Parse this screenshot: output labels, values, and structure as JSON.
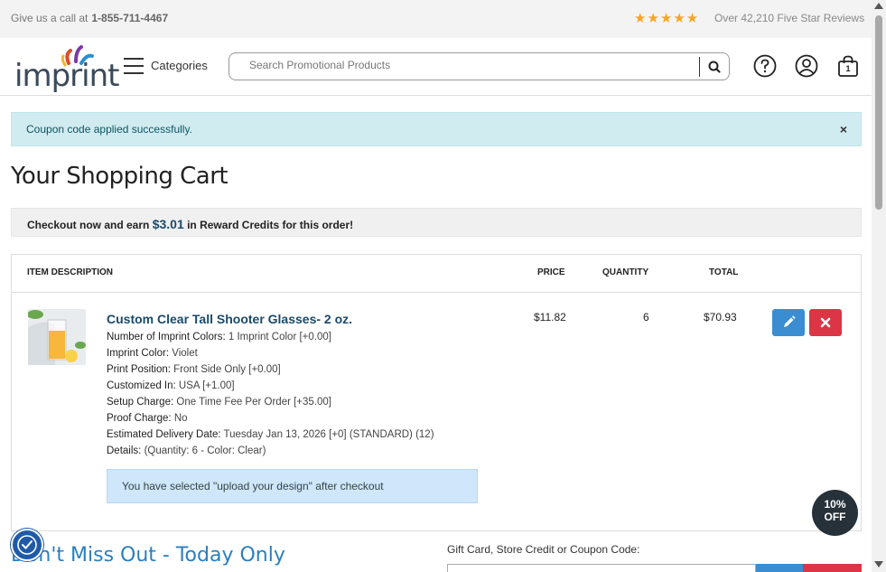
{
  "topbar": {
    "call_text": "Give us a call at",
    "phone": "1-855-711-4467",
    "stars": "★★★★★",
    "reviews": "Over 42,210 Five Star Reviews"
  },
  "header": {
    "logo_text": "imprint",
    "categories_label": "Categories",
    "search_placeholder": "Search Promotional Products",
    "cart_count": "1"
  },
  "alert": {
    "message": "Coupon code applied successfully.",
    "close": "×"
  },
  "page_title": "Your Shopping Cart",
  "reward": {
    "prefix": "Checkout now and earn",
    "amount": "$3.01",
    "suffix": "in Reward Credits for this order!"
  },
  "cart": {
    "columns": {
      "description": "ITEM DESCRIPTION",
      "price": "PRICE",
      "quantity": "QUANTITY",
      "total": "TOTAL"
    },
    "item": {
      "name": "Custom Clear Tall Shooter Glasses- 2 oz.",
      "price": "$11.82",
      "quantity": "6",
      "total": "$70.93",
      "details": [
        {
          "label": "Number of Imprint Colors:",
          "value": "1 Imprint Color [+0.00]"
        },
        {
          "label": "Imprint Color:",
          "value": "Violet"
        },
        {
          "label": "Print Position:",
          "value": "Front Side Only [+0.00]"
        },
        {
          "label": "Customized In:",
          "value": "USA [+1.00]"
        },
        {
          "label": "Setup Charge:",
          "value": "One Time Fee Per Order [+35.00]"
        },
        {
          "label": "Proof Charge:",
          "value": "No"
        },
        {
          "label": "Estimated Delivery Date:",
          "value": "Tuesday Jan 13, 2026 [+0] (STANDARD) (12)"
        },
        {
          "label": "Details:",
          "value": "(Quantity: 6 - Color: Clear)"
        }
      ],
      "upload_note": "You have selected \"upload your design\" after checkout"
    }
  },
  "promo": {
    "heading": "Don't Miss Out - Today Only",
    "gift_label": "Gift Card, Store Credit or Coupon Code:"
  },
  "badge": {
    "line1": "10%",
    "line2": "OFF"
  },
  "colors": {
    "accent": "#1a4a6a",
    "info_bg": "#d1ecf1",
    "edit_btn": "#3a8dd0",
    "delete_btn": "#dc3545",
    "star": "#f5a623"
  }
}
